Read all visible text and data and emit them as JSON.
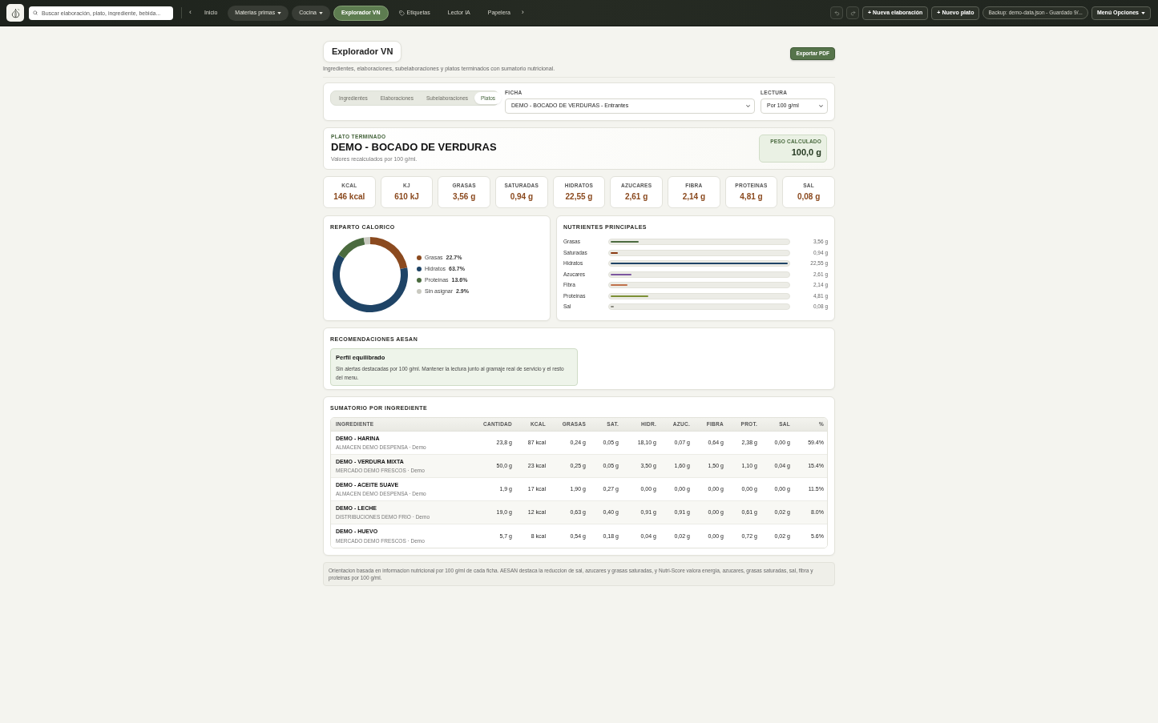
{
  "top_bar": {
    "search": {
      "placeholder": "Buscar elaboración, plato, ingrediente, bebida..."
    },
    "scroll_left": "‹",
    "nav_items": [
      {
        "label": "Inicio",
        "kind": "link",
        "selected": false
      },
      {
        "label": "Materias primas",
        "kind": "dropdown",
        "selected": false
      },
      {
        "label": "Cocina",
        "kind": "dropdown",
        "selected": false
      },
      {
        "label": "Explorador VN",
        "kind": "link",
        "selected": true
      },
      {
        "label": "Etiquetas",
        "kind": "tag-link",
        "selected": false
      },
      {
        "label": "Lector IA",
        "kind": "link",
        "selected": false
      },
      {
        "label": "Papelera",
        "kind": "link",
        "selected": false
      }
    ],
    "scroll_right": "›",
    "buttons": [
      "+ Nueva elaboración",
      "+ Nuevo plato"
    ],
    "backup_status": "Backup: demo-data.json - Guardado 9/...",
    "menu": "Menú Opciones"
  },
  "header": {
    "title": "Explorador VN",
    "subtitle": "Ingredientes, elaboraciones, subelaboraciones y platos terminados con sumatorio nutricional.",
    "export_button": "Exportar PDF"
  },
  "selector": {
    "tabs": [
      {
        "label": "Ingredientes",
        "selected": false
      },
      {
        "label": "Elaboraciones",
        "selected": false
      },
      {
        "label": "Subelaboraciones",
        "selected": false
      },
      {
        "label": "Platos",
        "selected": true
      }
    ],
    "ficha": {
      "label": "FICHA",
      "value": "DEMO - BOCADO DE VERDURAS - Entrantes"
    },
    "lectura": {
      "label": "LECTURA",
      "value": "Por 100 g/ml"
    }
  },
  "plate": {
    "eyebrow": "PLATO TERMINADO",
    "name": "DEMO - BOCADO DE VERDURAS",
    "note": "Valores recalculados por 100 g/ml.",
    "weight": {
      "label": "PESO CALCULADO",
      "value": "100,0 g"
    }
  },
  "metrics": [
    {
      "label": "KCAL",
      "value": "146 kcal"
    },
    {
      "label": "KJ",
      "value": "610 kJ"
    },
    {
      "label": "GRASAS",
      "value": "3,56 g"
    },
    {
      "label": "SATURADAS",
      "value": "0,94 g"
    },
    {
      "label": "HIDRATOS",
      "value": "22,55 g"
    },
    {
      "label": "AZUCARES",
      "value": "2,61 g"
    },
    {
      "label": "FIBRA",
      "value": "2,14 g"
    },
    {
      "label": "PROTEINAS",
      "value": "4,81 g"
    },
    {
      "label": "SAL",
      "value": "0,08 g"
    }
  ],
  "caloric_split": {
    "title": "REPARTO CALORICO",
    "chart_data": {
      "type": "donut",
      "categories": [
        "Grasas",
        "Hidratos",
        "Proteinas",
        "Sin asignar"
      ],
      "values": [
        22.06,
        61.9,
        13.22,
        2.82
      ]
    },
    "legend": [
      {
        "value": "22.7%",
        "color": "#8b4a1f"
      },
      {
        "value": "63.7%",
        "color": "#1f4466"
      },
      {
        "value": "13.6%",
        "color": "#4b6b3f"
      },
      {
        "value": "2.9%",
        "color": "#c9c9c0"
      }
    ]
  },
  "nutrients": {
    "title": "NUTRIENTES PRINCIPALES",
    "items": [
      {
        "label": "Grasas",
        "level": 0.158,
        "value": "3,56 g",
        "color": "#4b6b3f"
      },
      {
        "label": "Saturadas",
        "level": 0.042,
        "value": "0,94 g",
        "color": "#8b3a12"
      },
      {
        "label": "Hidratos",
        "level": 1,
        "value": "22,55 g",
        "color": "#1f4466"
      },
      {
        "label": "Azucares",
        "level": 0.116,
        "value": "2,61 g",
        "color": "#7d56a0"
      },
      {
        "label": "Fibra",
        "level": 0.095,
        "value": "2,14 g",
        "color": "#c0714a"
      },
      {
        "label": "Proteinas",
        "level": 0.213,
        "value": "4,81 g",
        "color": "#7c8f35"
      },
      {
        "label": "Sal",
        "level": 0.004,
        "value": "0,08 g",
        "color": "#8a8a80"
      }
    ]
  },
  "aesan": {
    "title": "RECOMENDACIONES AESAN",
    "recommendation": {
      "title": "Perfil equilibrado",
      "text": "Sin alertas destacadas por 100 g/ml. Mantener la lectura junto al gramaje real de servicio y el resto del menu."
    }
  },
  "table": {
    "title": "SUMATORIO POR INGREDIENTE",
    "columns": [
      "INGREDIENTE",
      "CANTIDAD",
      "KCAL",
      "GRASAS",
      "SAT.",
      "HIDR.",
      "AZUC.",
      "FIBRA",
      "PROT.",
      "SAL",
      "%"
    ],
    "rows": [
      {
        "name": "DEMO - HARINA",
        "supplier": "ALMACEN DEMO DESPENSA · Demo",
        "values": [
          "23,8 g",
          "87 kcal",
          "0,24 g",
          "0,05 g",
          "18,10 g",
          "0,07 g",
          "0,64 g",
          "2,38 g",
          "0,00 g",
          "59.4%"
        ]
      },
      {
        "name": "DEMO - VERDURA MIXTA",
        "supplier": "MERCADO DEMO FRESCOS · Demo",
        "values": [
          "50,0 g",
          "23 kcal",
          "0,25 g",
          "0,05 g",
          "3,50 g",
          "1,60 g",
          "1,50 g",
          "1,10 g",
          "0,04 g",
          "15.4%"
        ]
      },
      {
        "name": "DEMO - ACEITE SUAVE",
        "supplier": "ALMACEN DEMO DESPENSA · Demo",
        "values": [
          "1,9 g",
          "17 kcal",
          "1,90 g",
          "0,27 g",
          "0,00 g",
          "0,00 g",
          "0,00 g",
          "0,00 g",
          "0,00 g",
          "11.5%"
        ]
      },
      {
        "name": "DEMO - LECHE",
        "supplier": "DISTRIBUCIONES DEMO FRIO · Demo",
        "values": [
          "19,0 g",
          "12 kcal",
          "0,63 g",
          "0,40 g",
          "0,91 g",
          "0,91 g",
          "0,00 g",
          "0,61 g",
          "0,02 g",
          "8.0%"
        ]
      },
      {
        "name": "DEMO - HUEVO",
        "supplier": "MERCADO DEMO FRESCOS · Demo",
        "values": [
          "5,7 g",
          "8 kcal",
          "0,54 g",
          "0,18 g",
          "0,04 g",
          "0,02 g",
          "0,00 g",
          "0,72 g",
          "0,02 g",
          "5.6%"
        ]
      }
    ]
  },
  "footnote": "Orientacion basada en informacion nutricional por 100 g/ml de cada ficha. AESAN destaca la reduccion de sal, azucares y grasas saturadas, y Nutri-Score valora energia, azucares, grasas saturadas, sal, fibra y proteinas por 100 g/ml."
}
